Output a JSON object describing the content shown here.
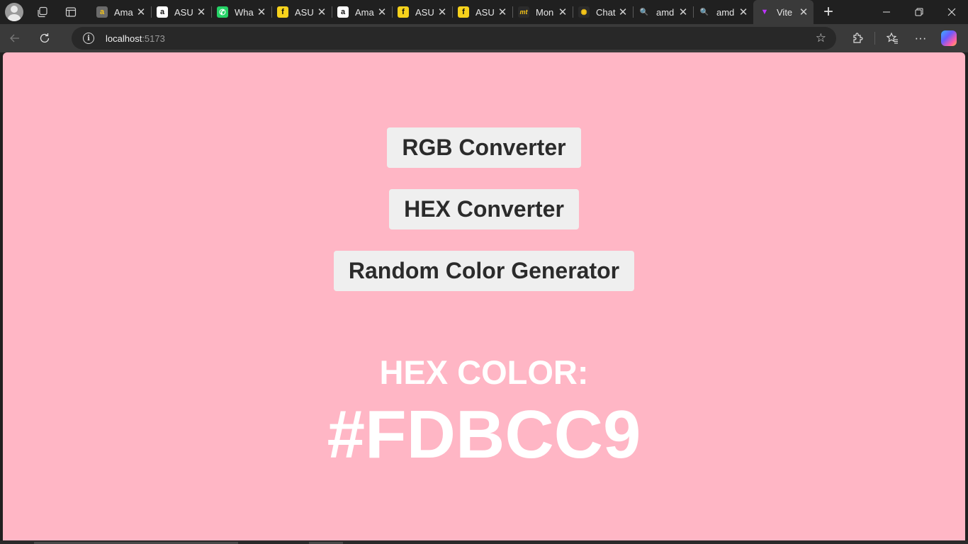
{
  "browser": {
    "tabs": [
      {
        "title": "Ama",
        "icon": "amazon-icon",
        "icon_color": "#6b6b6b",
        "icon_glyph": "a"
      },
      {
        "title": "ASU",
        "icon": "amazon-icon",
        "icon_color": "#ffffff",
        "icon_glyph": "a"
      },
      {
        "title": "Wha",
        "icon": "whatsapp-icon",
        "icon_color": "#25d366",
        "icon_glyph": "✆"
      },
      {
        "title": "ASU",
        "icon": "flipkart-icon",
        "icon_color": "#f7d21c",
        "icon_glyph": "f"
      },
      {
        "title": "Ama",
        "icon": "amazon-icon",
        "icon_color": "#ffffff",
        "icon_glyph": "a"
      },
      {
        "title": "ASU",
        "icon": "flipkart-icon",
        "icon_color": "#f7d21c",
        "icon_glyph": "f"
      },
      {
        "title": "ASU",
        "icon": "flipkart-icon",
        "icon_color": "#f7d21c",
        "icon_glyph": "f"
      },
      {
        "title": "Mon",
        "icon": "moneycontrol-icon",
        "icon_color": "#2b2b2b",
        "icon_glyph": "mt"
      },
      {
        "title": "Chat",
        "icon": "chatgpt-icon",
        "icon_color": "#2b2b2b",
        "icon_glyph": "✺"
      },
      {
        "title": "amd",
        "icon": "search-icon",
        "icon_color": "#202020",
        "icon_glyph": "🔍"
      },
      {
        "title": "amd",
        "icon": "search-icon",
        "icon_color": "#202020",
        "icon_glyph": "🔍"
      },
      {
        "title": "Vite",
        "icon": "vite-icon",
        "icon_color": "#3a3a3a",
        "icon_glyph": "▼",
        "active": true
      }
    ],
    "address": {
      "host": "localhost",
      "port": ":5173"
    }
  },
  "app": {
    "background": "#ffb6c5",
    "buttons": {
      "rgb": "RGB Converter",
      "hex": "HEX Converter",
      "random": "Random Color Generator"
    },
    "color_label": "HEX COLOR:",
    "color_value": "#FDBCC9"
  }
}
